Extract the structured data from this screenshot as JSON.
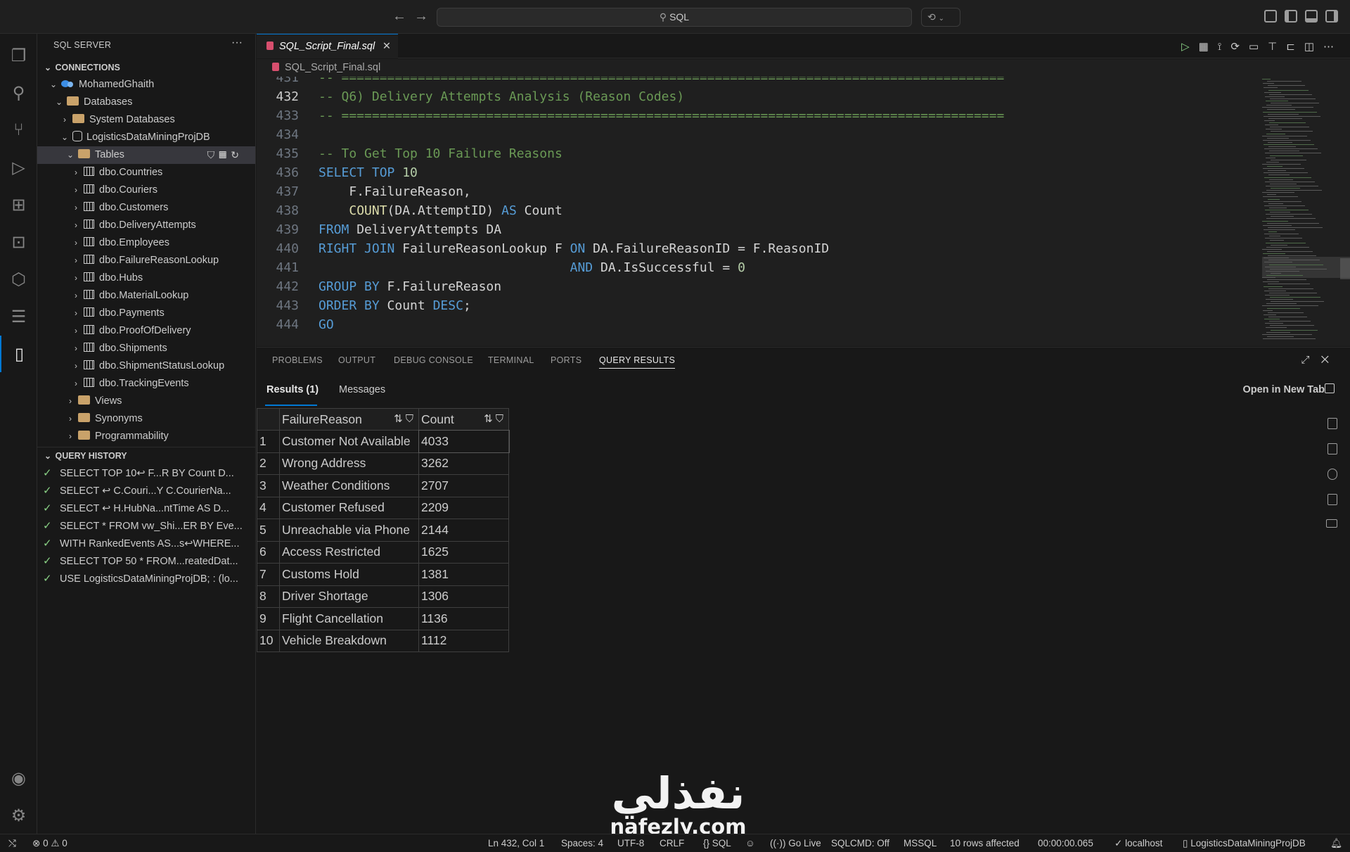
{
  "titlebar": {
    "back": "←",
    "forward": "→",
    "search": "SQL"
  },
  "activity_bar": {
    "icons": [
      "files-icon",
      "search-icon",
      "source-control-icon",
      "run-debug-icon",
      "extensions-icon",
      "remote-explorer-icon",
      "database-projects-icon",
      "query-history-icon",
      "sql-server-icon",
      "account-icon",
      "settings-icon"
    ]
  },
  "sidebar": {
    "title": "SQL SERVER",
    "more": "···",
    "connections_header": "CONNECTIONS",
    "tree": [
      {
        "label": "MohamedGhaith",
        "type": "server"
      },
      {
        "label": "Databases",
        "type": "folder"
      },
      {
        "label": "System Databases",
        "type": "folder"
      },
      {
        "label": "LogisticsDataMiningProjDB",
        "type": "database"
      },
      {
        "label": "Tables",
        "type": "folder"
      },
      {
        "label": "dbo.Countries",
        "type": "table"
      },
      {
        "label": "dbo.Couriers",
        "type": "table"
      },
      {
        "label": "dbo.Customers",
        "type": "table"
      },
      {
        "label": "dbo.DeliveryAttempts",
        "type": "table"
      },
      {
        "label": "dbo.Employees",
        "type": "table"
      },
      {
        "label": "dbo.FailureReasonLookup",
        "type": "table"
      },
      {
        "label": "dbo.Hubs",
        "type": "table"
      },
      {
        "label": "dbo.MaterialLookup",
        "type": "table"
      },
      {
        "label": "dbo.Payments",
        "type": "table"
      },
      {
        "label": "dbo.ProofOfDelivery",
        "type": "table"
      },
      {
        "label": "dbo.Shipments",
        "type": "table"
      },
      {
        "label": "dbo.ShipmentStatusLookup",
        "type": "table"
      },
      {
        "label": "dbo.TrackingEvents",
        "type": "table"
      },
      {
        "label": "Views",
        "type": "folder"
      },
      {
        "label": "Synonyms",
        "type": "folder"
      },
      {
        "label": "Programmability",
        "type": "folder"
      }
    ],
    "query_history_header": "QUERY HISTORY",
    "history": [
      "SELECT TOP 10↩     F...R BY Count D...",
      "SELECT ↩     C.Couri...Y C.CourierNa...",
      "SELECT ↩     H.HubNa...ntTime AS D...",
      "SELECT * FROM vw_Shi...ER BY Eve...",
      "WITH RankedEvents AS...s↩WHERE...",
      "SELECT TOP 50 * FROM...reatedDat...",
      "USE LogisticsDataMiningProjDB; : (lo..."
    ]
  },
  "editor": {
    "tab_label": "SQL_Script_Final.sql",
    "close": "✕",
    "breadcrumb": "SQL_Script_Final.sql",
    "current_line": 432
  },
  "code_lines": [
    {
      "n": "431",
      "html": "<span class='cm'>-- =======================================================================================</span>"
    },
    {
      "n": "432",
      "html": "<span class='cm'>-- Q6) Delivery Attempts Analysis (Reason Codes)</span>"
    },
    {
      "n": "433",
      "html": "<span class='cm'>-- =======================================================================================</span>"
    },
    {
      "n": "434",
      "html": ""
    },
    {
      "n": "435",
      "html": "<span class='cm'>-- To Get Top 10 Failure Reasons</span>"
    },
    {
      "n": "436",
      "html": "<span class='kw'>SELECT TOP</span> <span class='num'>10</span>"
    },
    {
      "n": "437",
      "html": "    <span class='id'>F.FailureReason,</span>"
    },
    {
      "n": "438",
      "html": "    <span class='fn'>COUNT</span><span class='id'>(DA.AttemptID)</span> <span class='kw'>AS</span> <span class='id'>Count</span>"
    },
    {
      "n": "439",
      "html": "<span class='kw'>FROM</span> <span class='id'>DeliveryAttempts DA</span>"
    },
    {
      "n": "440",
      "html": "<span class='kw'>RIGHT JOIN</span> <span class='id'>FailureReasonLookup F</span> <span class='kw'>ON</span> <span class='id'>DA.FailureReasonID = F.ReasonID</span>"
    },
    {
      "n": "441",
      "html": "                                 <span class='kw'>AND</span> <span class='id'>DA.IsSuccessful = </span><span class='num'>0</span>"
    },
    {
      "n": "442",
      "html": "<span class='kw'>GROUP BY</span> <span class='id'>F.FailureReason</span>"
    },
    {
      "n": "443",
      "html": "<span class='kw'>ORDER BY</span> <span class='id'>Count</span> <span class='kw'>DESC</span><span class='id'>;</span>"
    },
    {
      "n": "444",
      "html": "<span class='kw'>GO</span>"
    }
  ],
  "panel": {
    "tabs": [
      "PROBLEMS",
      "OUTPUT",
      "DEBUG CONSOLE",
      "TERMINAL",
      "PORTS",
      "QUERY RESULTS"
    ],
    "active_tab": "QUERY RESULTS",
    "result_tabs": [
      "Results (1)",
      "Messages"
    ],
    "open_new_tab": "Open in New Tab"
  },
  "results": {
    "columns": [
      "FailureReason",
      "Count"
    ],
    "rows": [
      [
        "1",
        "Customer Not Available",
        "4033"
      ],
      [
        "2",
        "Wrong Address",
        "3262"
      ],
      [
        "3",
        "Weather Conditions",
        "2707"
      ],
      [
        "4",
        "Customer Refused",
        "2209"
      ],
      [
        "5",
        "Unreachable via Phone",
        "2144"
      ],
      [
        "6",
        "Access Restricted",
        "1625"
      ],
      [
        "7",
        "Customs Hold",
        "1381"
      ],
      [
        "8",
        "Driver Shortage",
        "1306"
      ],
      [
        "9",
        "Flight Cancellation",
        "1136"
      ],
      [
        "10",
        "Vehicle Breakdown",
        "1112"
      ]
    ]
  },
  "watermark": {
    "arabic": "نفذلي",
    "latin": "nafezly.com"
  },
  "statusbar": {
    "errors": "0",
    "warnings": "0",
    "position": "Ln 432, Col 1",
    "spaces": "Spaces: 4",
    "encoding": "UTF-8",
    "eol": "CRLF",
    "language": "SQL",
    "go_live": "Go Live",
    "sqlcmd": "SQLCMD: Off",
    "dialect": "MSSQL",
    "rows_affected": "10 rows affected",
    "elapsed": "00:00:00.065",
    "server": "localhost",
    "database": "LogisticsDataMiningProjDB"
  }
}
